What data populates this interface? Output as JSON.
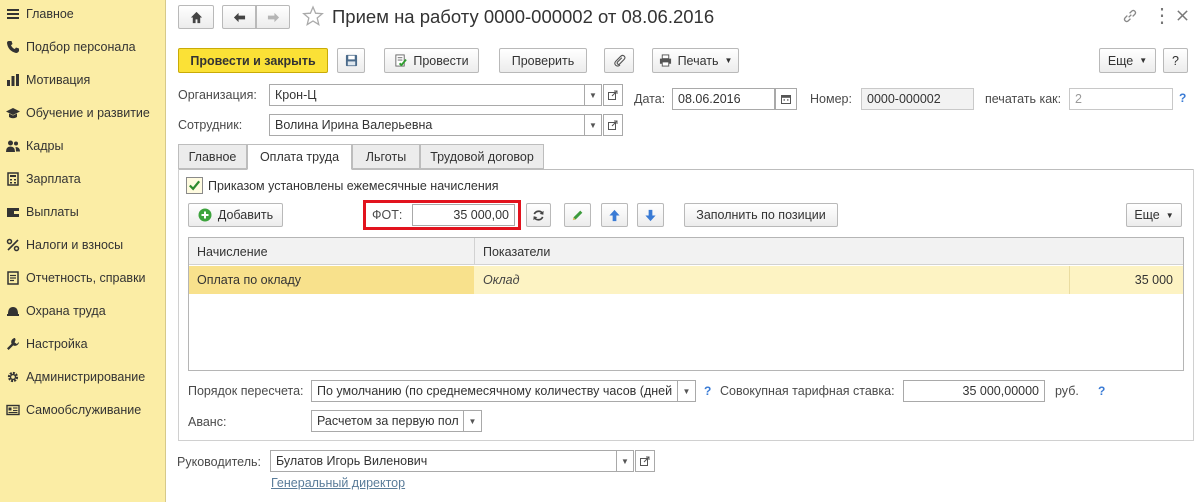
{
  "sidebar": {
    "items": [
      {
        "label": "Главное",
        "icon": "menu-icon"
      },
      {
        "label": "Подбор персонала",
        "icon": "phone-icon"
      },
      {
        "label": "Мотивация",
        "icon": "chart-bars-icon"
      },
      {
        "label": "Обучение и развитие",
        "icon": "graduation-cap-icon"
      },
      {
        "label": "Кадры",
        "icon": "people-icon"
      },
      {
        "label": "Зарплата",
        "icon": "calculator-icon"
      },
      {
        "label": "Выплаты",
        "icon": "wallet-icon"
      },
      {
        "label": "Налоги и взносы",
        "icon": "percent-icon"
      },
      {
        "label": "Отчетность, справки",
        "icon": "report-icon"
      },
      {
        "label": "Охрана труда",
        "icon": "helmet-icon"
      },
      {
        "label": "Настройка",
        "icon": "wrench-icon"
      },
      {
        "label": "Администрирование",
        "icon": "gear-icon"
      },
      {
        "label": "Самообслуживание",
        "icon": "id-card-icon"
      }
    ]
  },
  "header": {
    "title": "Прием на работу 0000-000002 от 08.06.2016"
  },
  "toolbar": {
    "post_close": "Провести и закрыть",
    "post": "Провести",
    "check": "Проверить",
    "print": "Печать",
    "more": "Еще",
    "help": "?"
  },
  "form": {
    "org_label": "Организация:",
    "org_value": "Крон-Ц",
    "date_label": "Дата:",
    "date_value": "08.06.2016",
    "number_label": "Номер:",
    "number_value": "0000-000002",
    "print_as_label": "печатать как:",
    "print_as_value": "2",
    "employee_label": "Сотрудник:",
    "employee_value": "Волина Ирина Валерьевна"
  },
  "tabs": [
    {
      "label": "Главное",
      "active": false
    },
    {
      "label": "Оплата труда",
      "active": true
    },
    {
      "label": "Льготы",
      "active": false
    },
    {
      "label": "Трудовой договор",
      "active": false
    }
  ],
  "pay": {
    "monthly_checkbox_label": "Приказом установлены ежемесячные начисления",
    "monthly_checked": true,
    "add_button": "Добавить",
    "fot_label": "ФОТ:",
    "fot_value": "35 000,00",
    "fill_by_position": "Заполнить по позиции",
    "more": "Еще"
  },
  "grid": {
    "columns": [
      "Начисление",
      "Показатели"
    ],
    "rows": [
      {
        "accrual": "Оплата по окладу",
        "indicator": "Оклад",
        "value": "35 000"
      }
    ]
  },
  "recalc": {
    "label": "Порядок пересчета:",
    "value": "По умолчанию (по среднемесячному количеству часов (дней",
    "rate_label": "Совокупная тарифная ставка:",
    "rate_value": "35 000,00000",
    "rate_unit": "руб."
  },
  "advance": {
    "label": "Аванс:",
    "value": "Расчетом за первую пол"
  },
  "manager": {
    "label": "Руководитель:",
    "value": "Булатов Игорь Виленович",
    "position_link": "Генеральный директор"
  },
  "colors": {
    "sidebar_bg": "#fbeda5",
    "primary_button": "#fbe136",
    "highlight_red": "#e2131e",
    "selected_row": "#fdf3c3",
    "help_blue": "#3a7bd5"
  }
}
